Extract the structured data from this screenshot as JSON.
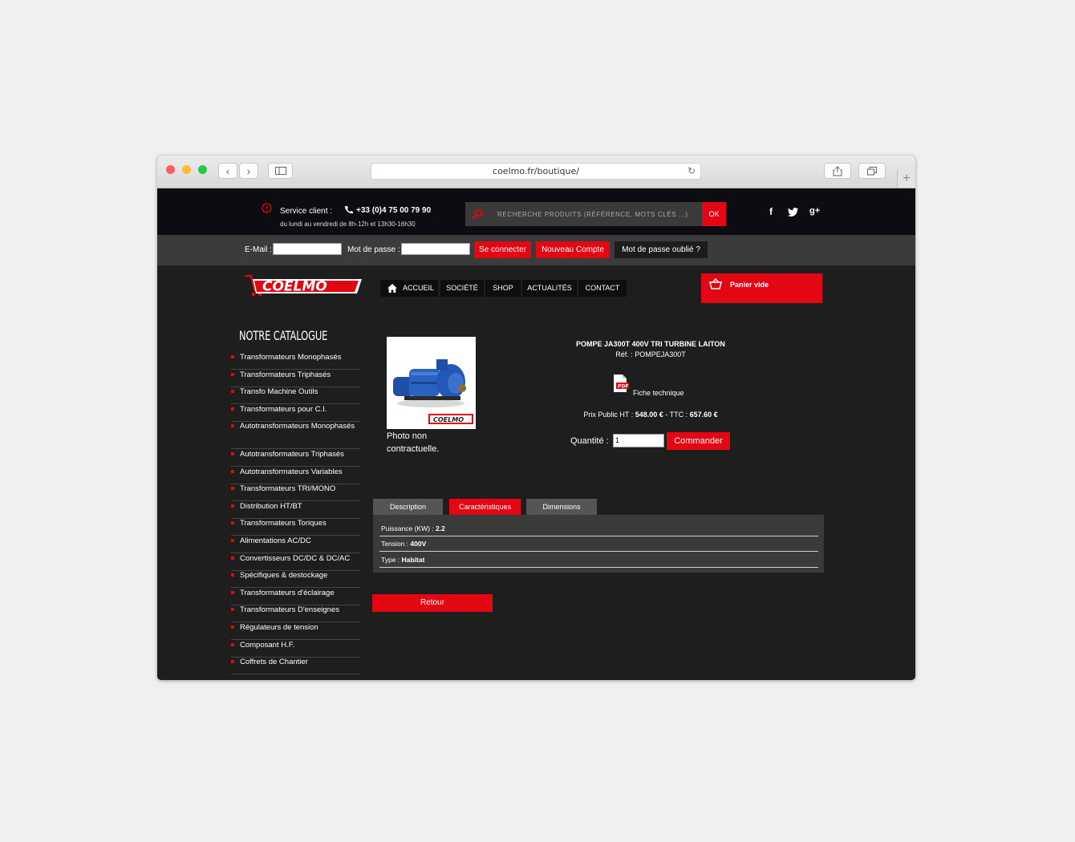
{
  "browser": {
    "url": "coelmo.fr/boutique/"
  },
  "header": {
    "service_label": "Service client :",
    "phone": "+33 (0)4 75 00 79 90",
    "hours": "du lundi au vendredi de 8h-12h et 13h30-16h30",
    "search_placeholder": "RECHERCHE PRODUITS (RÉFÉRENCE, MOTS CLÉS ...)",
    "search_button": "OK",
    "social": [
      "f",
      "g+"
    ]
  },
  "login": {
    "email_label": "E-Mail :",
    "password_label": "Mot de passe :",
    "connect_button": "Se connecter",
    "new_account_button": "Nouveau Compte",
    "forgot_button": "Mot de passe oublié ?"
  },
  "nav": {
    "logo_text": "COELMO",
    "items": [
      "ACCUEIL",
      "SOCIÉTÉ",
      "SHOP",
      "ACTUALITÉS",
      "CONTACT"
    ],
    "active": "SHOP",
    "cart_label": "Panier vide"
  },
  "catalogue": {
    "title": "NOTRE CATALOGUE",
    "items": [
      "Transformateurs Monophasés",
      "Transformateurs Triphasés",
      "Transfo Machine Outils",
      "Transformateurs pour C.I.",
      "Autotransformateurs Monophasés",
      "Autotransformateurs Triphasés",
      "Autotransformateurs Variables",
      "Transformateurs TRI/MONO",
      "Distribution HT/BT",
      "Transformateurs Toriques",
      "Alimentations AC/DC",
      "Convertisseurs DC/DC & DC/AC",
      "Spécifiques & destockage",
      "Transformateurs d'éclairage",
      "Transformateurs D'enseignes",
      "Régulateurs de tension",
      "Composant H.F.",
      "Coffrets de Chantier"
    ]
  },
  "product": {
    "name": "POMPE JA300T 400V TRI TURBINE LAITON",
    "ref": "Réf. : POMPEJA300T",
    "photo_note": "Photo non contractuelle.",
    "pdf_label": "PDF",
    "datasheet": "Fiche technique",
    "price_ht_label": "Prix Public HT : ",
    "price_ht": "548.00 €",
    "price_sep": " - TTC : ",
    "price_ttc": "657.60 €",
    "qty_label": "Quantité :",
    "qty_value": "1",
    "order_button": "Commander",
    "image_logo": "COELMO"
  },
  "tabs": {
    "items": [
      "Description",
      "Caractéristiques",
      "Dimensions"
    ],
    "active": "Caractéristiques",
    "specs": [
      {
        "label": "Puissance (KW) : ",
        "value": "2.2"
      },
      {
        "label": "Tension : ",
        "value": "400V"
      },
      {
        "label": "Type : ",
        "value": "Habitat"
      }
    ]
  },
  "back_button": "Retour",
  "colors": {
    "accent": "#e30613",
    "background": "#1e1e1e",
    "topbar": "#0d0c13"
  }
}
